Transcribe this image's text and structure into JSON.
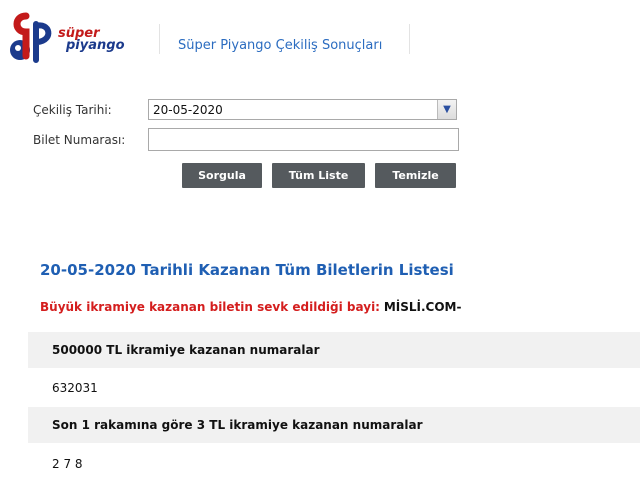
{
  "header": {
    "logo_line1": "süper",
    "logo_line2": "piyango",
    "site_title": "Süper Piyango Çekiliş Sonuçları"
  },
  "form": {
    "draw_date_label": "Çekiliş Tarihi:",
    "draw_date_value": "20-05-2020",
    "ticket_number_label": "Bilet Numarası:",
    "ticket_number_value": "",
    "buttons": {
      "query": "Sorgula",
      "all_list": "Tüm Liste",
      "clear": "Temizle"
    }
  },
  "results": {
    "title": "20-05-2020 Tarihli Kazanan Tüm Biletlerin Listesi",
    "dealer_label": "Büyük ikramiye kazanan biletin sevk edildiği bayi:",
    "dealer_name": "MİSLİ.COM-",
    "groups": [
      {
        "heading": "500000 TL ikramiye kazanan numaralar",
        "numbers": "632031"
      },
      {
        "heading": "Son 1 rakamına göre 3 TL ikramiye kazanan numaralar",
        "numbers": "2 7 8"
      }
    ]
  },
  "colors": {
    "accent_blue": "#1f5fb3",
    "alert_red": "#d41e1e",
    "button_gray": "#555a5e"
  }
}
